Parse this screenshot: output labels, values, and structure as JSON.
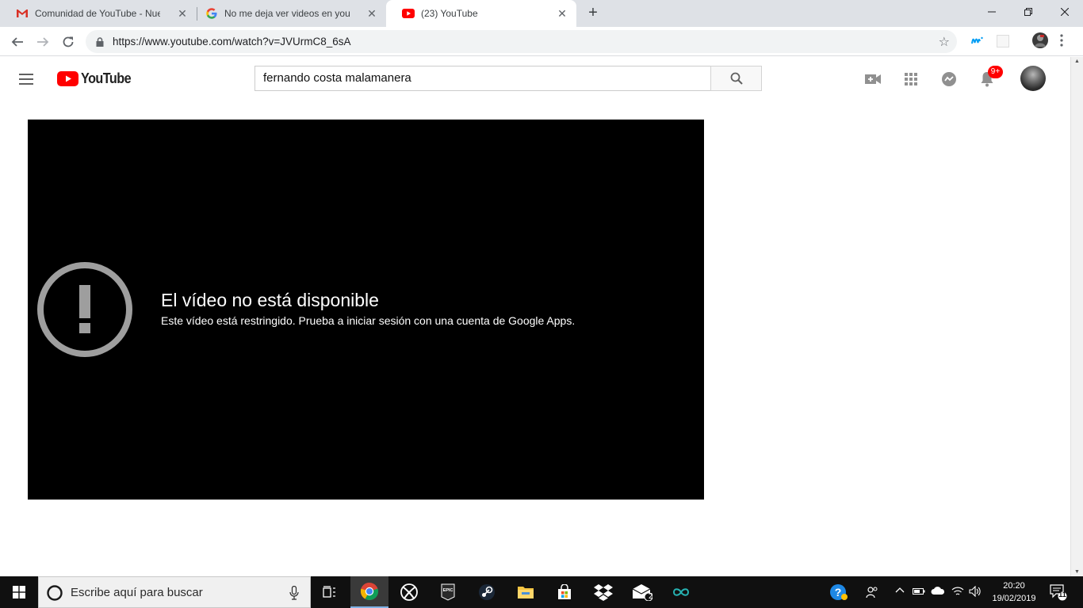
{
  "browser": {
    "tabs": [
      {
        "title": "Comunidad de YouTube - Nueva",
        "favicon": "gmail-icon"
      },
      {
        "title": "No me deja ver videos en youtub",
        "favicon": "google-icon"
      },
      {
        "title": "(23) YouTube",
        "favicon": "youtube-icon",
        "active": true
      }
    ],
    "url": "https://www.youtube.com/watch?v=JVUrmC8_6sA"
  },
  "youtube": {
    "logo_text": "YouTube",
    "search_value": "fernando costa malamanera",
    "notifications_badge": "9+"
  },
  "player": {
    "error_title": "El vídeo no está disponible",
    "error_message": "Este vídeo está restringido. Prueba a iniciar sesión con una cuenta de Google Apps."
  },
  "taskbar": {
    "search_placeholder": "Escribe aquí para buscar",
    "mail_count": "2",
    "notification_count": "11",
    "time": "20:20",
    "date": "19/02/2019"
  },
  "colors": {
    "youtube_red": "#ff0000",
    "chrome_tabstrip": "#dee1e6",
    "player_bg": "#000000",
    "taskbar_bg": "#101010"
  }
}
